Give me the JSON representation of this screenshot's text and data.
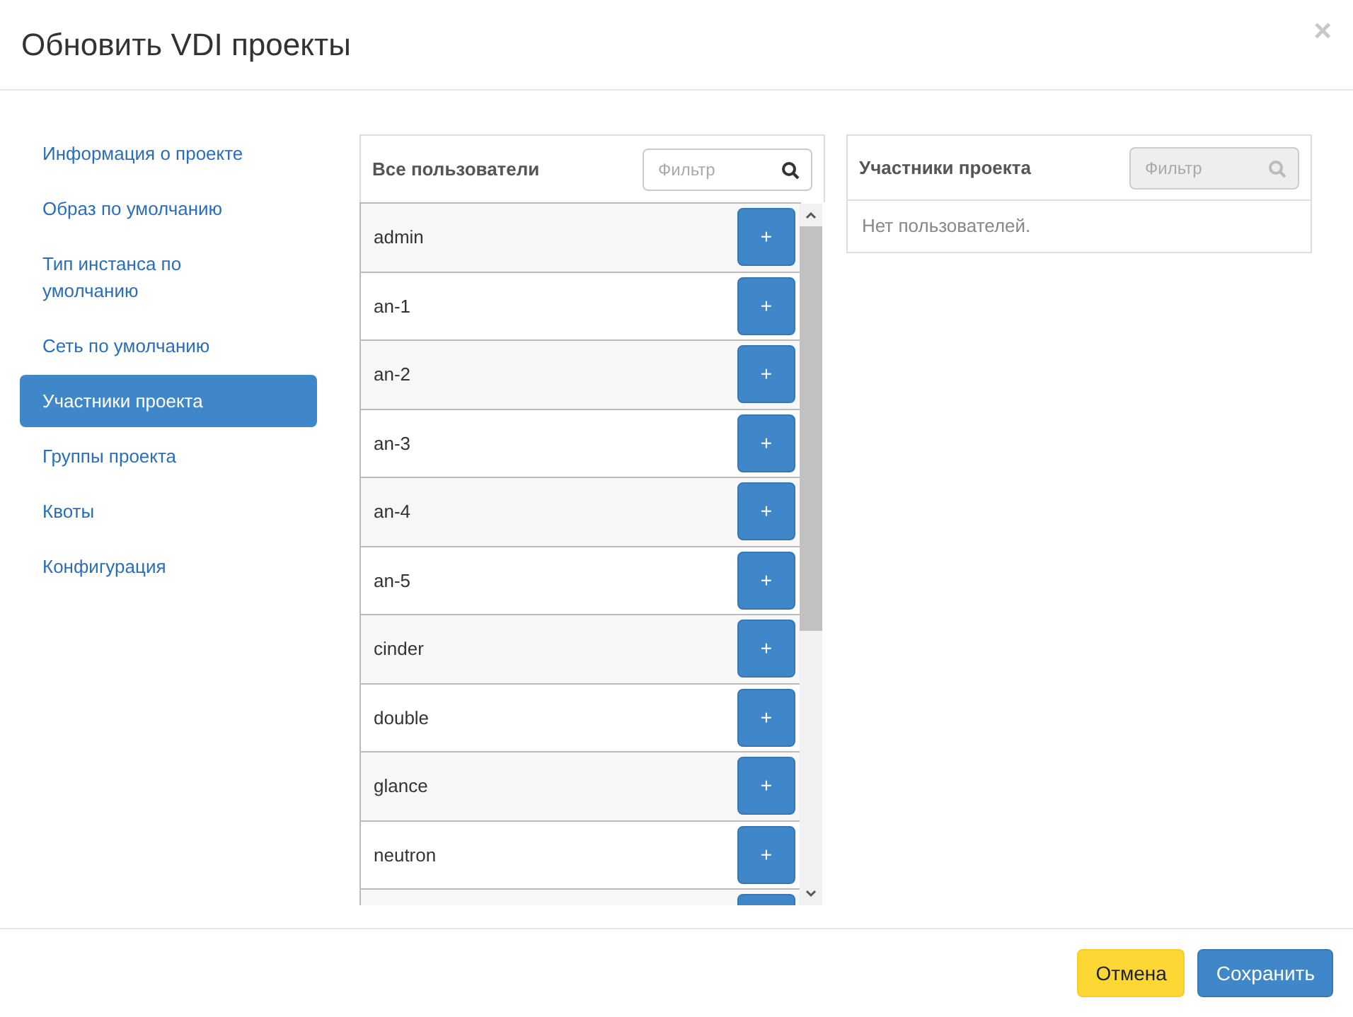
{
  "dialog": {
    "title": "Обновить VDI проекты",
    "close": "×"
  },
  "sidebar": {
    "items": [
      {
        "label": "Информация о проекте",
        "selected": false
      },
      {
        "label": "Образ по умолчанию",
        "selected": false
      },
      {
        "label": "Тип инстанса по умолчанию",
        "selected": false
      },
      {
        "label": "Сеть по умолчанию",
        "selected": false
      },
      {
        "label": "Участники проекта",
        "selected": true
      },
      {
        "label": "Группы проекта",
        "selected": false
      },
      {
        "label": "Квоты",
        "selected": false
      },
      {
        "label": "Конфигурация",
        "selected": false
      }
    ]
  },
  "all_users": {
    "title": "Все пользователи",
    "filter": {
      "placeholder": "Фильтр"
    },
    "rows": [
      {
        "name": "admin",
        "button": "+"
      },
      {
        "name": "an-1",
        "button": "+"
      },
      {
        "name": "an-2",
        "button": "+"
      },
      {
        "name": "an-3",
        "button": "+"
      },
      {
        "name": "an-4",
        "button": "+"
      },
      {
        "name": "an-5",
        "button": "+"
      },
      {
        "name": "cinder",
        "button": "+"
      },
      {
        "name": "double",
        "button": "+"
      },
      {
        "name": "glance",
        "button": "+"
      },
      {
        "name": "neutron",
        "button": "+"
      },
      {
        "kind": "cut"
      }
    ]
  },
  "members": {
    "title": "Участники проекта",
    "filter": {
      "placeholder": "Фильтр",
      "disabled": true
    },
    "empty_text": "Нет пользователей."
  },
  "footer": {
    "buttons": [
      {
        "label": "Отмена",
        "kind": "cancel"
      },
      {
        "label": "Сохранить",
        "kind": "primary"
      }
    ]
  }
}
